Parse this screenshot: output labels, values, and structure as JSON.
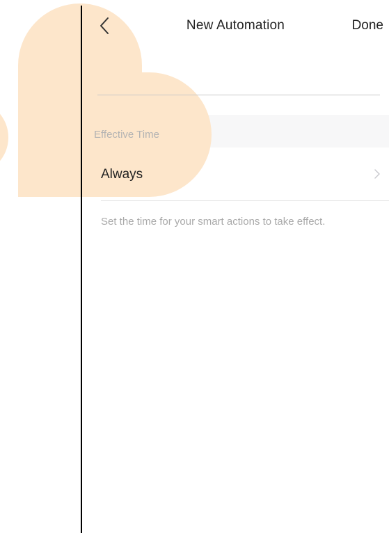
{
  "nav": {
    "title": "New Automation",
    "done_label": "Done",
    "back_icon": "chevron-left-icon"
  },
  "section": {
    "header_label": "Effective Time"
  },
  "effective_time_row": {
    "value": "Always",
    "chevron_icon": "chevron-right-icon"
  },
  "hint_text": "Set the time for your smart actions to take effect.",
  "colors": {
    "decoration": "#fde6cb",
    "text_primary": "#222222",
    "text_secondary": "#a9a9a9",
    "section_bg": "#f7f7f8"
  }
}
